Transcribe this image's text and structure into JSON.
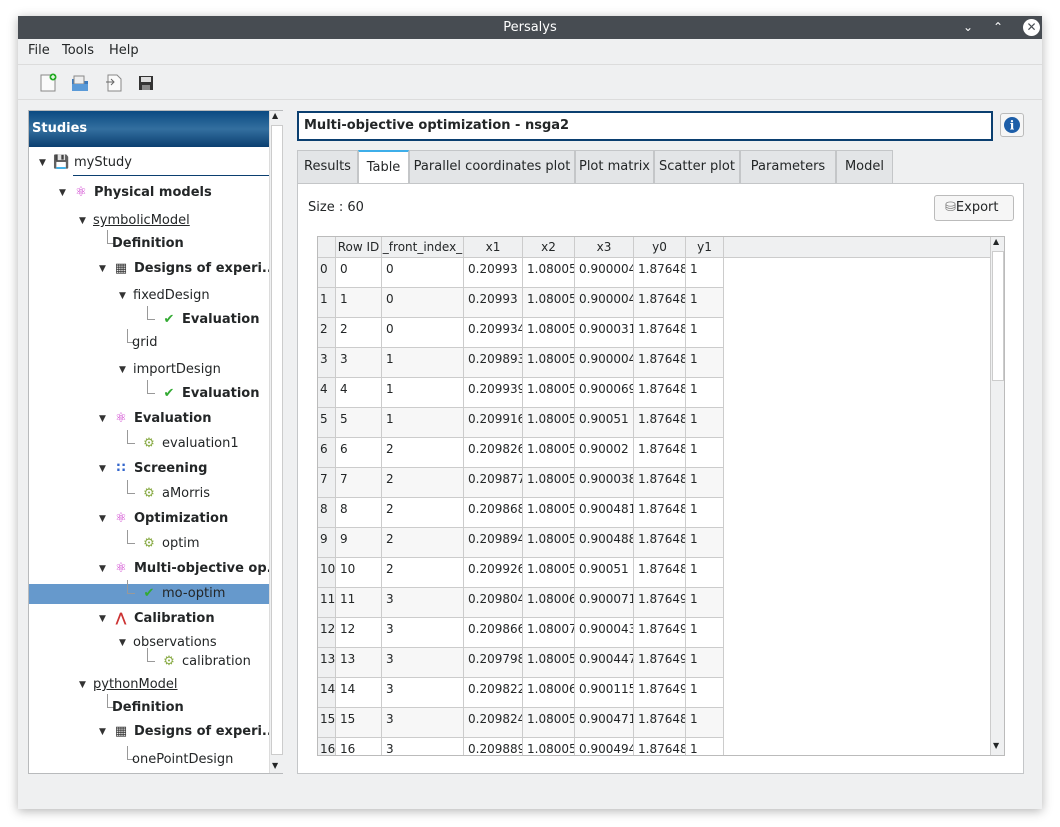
{
  "window": {
    "title": "Persalys"
  },
  "menu": [
    "File",
    "Tools",
    "Help"
  ],
  "toolbar": [
    {
      "icon": "new-study-icon"
    },
    {
      "icon": "open-study-icon"
    },
    {
      "icon": "import-script-icon"
    },
    {
      "icon": "save-icon"
    }
  ],
  "sidebar": {
    "title": "Studies",
    "items": [
      {
        "label": "myStudy",
        "level": 0,
        "arrow": true,
        "icon": "save-icon",
        "bold": false
      },
      {
        "label": "Physical models",
        "level": 1,
        "arrow": true,
        "icon": "physical-model-icon",
        "bold": true
      },
      {
        "label": "symbolicModel",
        "level": 2,
        "arrow": true,
        "icon": "",
        "bold": false,
        "underline": true
      },
      {
        "label": "Definition",
        "level": 3,
        "arrow": false,
        "icon": "",
        "bold": true
      },
      {
        "label": "Designs of experi...",
        "level": 3,
        "arrow": true,
        "icon": "table-icon",
        "bold": true
      },
      {
        "label": "fixedDesign",
        "level": 4,
        "arrow": true,
        "icon": "",
        "bold": false
      },
      {
        "label": "Evaluation",
        "level": 5,
        "arrow": false,
        "icon": "check-icon",
        "bold": true
      },
      {
        "label": "grid",
        "level": 4,
        "arrow": false,
        "icon": "",
        "bold": false
      },
      {
        "label": "importDesign",
        "level": 4,
        "arrow": true,
        "icon": "",
        "bold": false
      },
      {
        "label": "Evaluation",
        "level": 5,
        "arrow": false,
        "icon": "check-icon",
        "bold": true
      },
      {
        "label": "Evaluation",
        "level": 3,
        "arrow": true,
        "icon": "evaluation-icon",
        "bold": true
      },
      {
        "label": "evaluation1",
        "level": 4,
        "arrow": false,
        "icon": "gear-icon",
        "bold": false
      },
      {
        "label": "Screening",
        "level": 3,
        "arrow": true,
        "icon": "screening-icon",
        "bold": true
      },
      {
        "label": "aMorris",
        "level": 4,
        "arrow": false,
        "icon": "gear-icon",
        "bold": false
      },
      {
        "label": "Optimization",
        "level": 3,
        "arrow": true,
        "icon": "optimization-icon",
        "bold": true
      },
      {
        "label": "optim",
        "level": 4,
        "arrow": false,
        "icon": "gear-icon",
        "bold": false
      },
      {
        "label": "Multi-objective op...",
        "level": 3,
        "arrow": true,
        "icon": "optimization-icon",
        "bold": true
      },
      {
        "label": "mo-optim",
        "level": 4,
        "arrow": false,
        "icon": "check-icon",
        "bold": false,
        "selected": true
      },
      {
        "label": "Calibration",
        "level": 3,
        "arrow": true,
        "icon": "calibration-icon",
        "bold": true
      },
      {
        "label": "observations",
        "level": 4,
        "arrow": true,
        "icon": "",
        "bold": false
      },
      {
        "label": "calibration",
        "level": 5,
        "arrow": false,
        "icon": "gear-icon",
        "bold": false
      },
      {
        "label": "pythonModel",
        "level": 2,
        "arrow": true,
        "icon": "",
        "bold": false,
        "underline": true
      },
      {
        "label": "Definition",
        "level": 3,
        "arrow": false,
        "icon": "",
        "bold": true
      },
      {
        "label": "Designs of experi...",
        "level": 3,
        "arrow": true,
        "icon": "table-icon",
        "bold": true
      },
      {
        "label": "onePointDesign",
        "level": 4,
        "arrow": false,
        "icon": "",
        "bold": false
      }
    ]
  },
  "main": {
    "title": "Multi-objective optimization - nsga2",
    "tabs": [
      "Results",
      "Table",
      "Parallel coordinates plot",
      "Plot matrix",
      "Scatter plot",
      "Parameters",
      "Model"
    ],
    "active_tab": "Table",
    "size_label": "Size : 60",
    "export_label": "Export",
    "table": {
      "columns": [
        "Row ID",
        "_front_index_",
        "x1",
        "x2",
        "x3",
        "y0",
        "y1"
      ],
      "rows": [
        [
          "0",
          "0",
          "0.20993",
          "1.08005",
          "0.900004",
          "1.87648",
          "1"
        ],
        [
          "1",
          "0",
          "0.20993",
          "1.08005",
          "0.900004",
          "1.87648",
          "1"
        ],
        [
          "2",
          "0",
          "0.209934",
          "1.08005",
          "0.900031",
          "1.87648",
          "1"
        ],
        [
          "3",
          "1",
          "0.209893",
          "1.08005",
          "0.900004",
          "1.87648",
          "1"
        ],
        [
          "4",
          "1",
          "0.209939",
          "1.08005",
          "0.900069",
          "1.87648",
          "1"
        ],
        [
          "5",
          "1",
          "0.209916",
          "1.08005",
          "0.90051",
          "1.87648",
          "1"
        ],
        [
          "6",
          "2",
          "0.209826",
          "1.08005",
          "0.90002",
          "1.87648",
          "1"
        ],
        [
          "7",
          "2",
          "0.209877",
          "1.08005",
          "0.900038",
          "1.87648",
          "1"
        ],
        [
          "8",
          "2",
          "0.209868",
          "1.08005",
          "0.900481",
          "1.87648",
          "1"
        ],
        [
          "9",
          "2",
          "0.209894",
          "1.08005",
          "0.900488",
          "1.87648",
          "1"
        ],
        [
          "10",
          "2",
          "0.209926",
          "1.08005",
          "0.90051",
          "1.87648",
          "1"
        ],
        [
          "11",
          "3",
          "0.209804",
          "1.08006",
          "0.900071",
          "1.87649",
          "1"
        ],
        [
          "12",
          "3",
          "0.209866",
          "1.08007",
          "0.900043",
          "1.87649",
          "1"
        ],
        [
          "13",
          "3",
          "0.209798",
          "1.08005",
          "0.900447",
          "1.87649",
          "1"
        ],
        [
          "14",
          "3",
          "0.209822",
          "1.08006",
          "0.900115",
          "1.87649",
          "1"
        ],
        [
          "15",
          "3",
          "0.209824",
          "1.08005",
          "0.900471",
          "1.87648",
          "1"
        ],
        [
          "16",
          "3",
          "0.209889",
          "1.08005",
          "0.900494",
          "1.87648",
          "1"
        ]
      ]
    }
  }
}
